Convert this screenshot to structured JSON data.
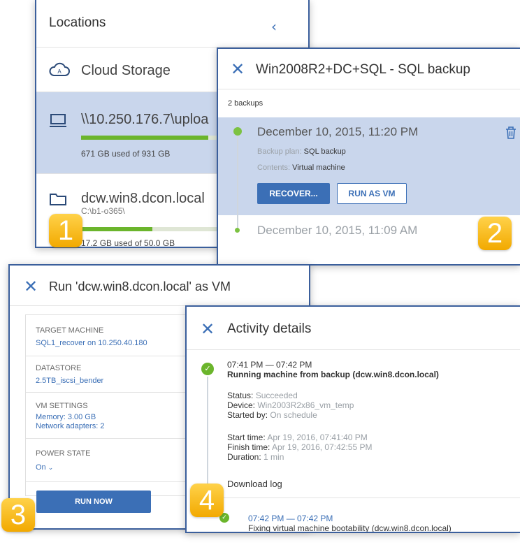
{
  "locations_panel": {
    "title": "Locations",
    "collapse_icon": "chevron-left-icon",
    "items": [
      {
        "icon": "cloud-icon",
        "name": "Cloud Storage"
      },
      {
        "icon": "computer-icon",
        "name": "\\\\10.250.176.7\\uploa",
        "usage": "671 GB used of 931 GB",
        "usage_fraction": 0.79,
        "selected": true
      },
      {
        "icon": "folder-icon",
        "name": "dcw.win8.dcon.local",
        "path": "C:\\b1-o365\\",
        "usage": "17.2 GB used of 50.0 GB",
        "usage_fraction": 0.34
      }
    ]
  },
  "backups_panel": {
    "title": "Win2008R2+DC+SQL - SQL backup",
    "count_label": "2 backups",
    "backups": [
      {
        "date": "December 10, 2015, 11:20 PM",
        "plan_label": "Backup plan:",
        "plan_value": "SQL backup",
        "contents_label": "Contents:",
        "contents_value": "Virtual machine",
        "recover_button": "RECOVER...",
        "run_vm_button": "RUN AS VM"
      },
      {
        "date": "December 10, 2015, 11:09 AM"
      }
    ]
  },
  "run_vm_panel": {
    "title": "Run 'dcw.win8.dcon.local' as VM",
    "target_label": "TARGET MACHINE",
    "target_value": "SQL1_recover on 10.250.40.180",
    "datastore_label": "DATASTORE",
    "datastore_value": "2.5TB_iscsi_bender",
    "settings_label": "VM SETTINGS",
    "memory": "Memory: 3.00 GB",
    "adapters": "Network adapters: 2",
    "power_label": "POWER STATE",
    "power_value": "On",
    "run_button": "RUN NOW"
  },
  "activity_panel": {
    "title": "Activity details",
    "activity1": {
      "time": "07:41 PM — 07:42 PM",
      "name": "Running machine from backup (dcw.win8.dcon.local)",
      "status_label": "Status:",
      "status_value": "Succeeded",
      "device_label": "Device:",
      "device_value": "Win2003R2x86_vm_temp",
      "started_label": "Started by:",
      "started_value": "On schedule",
      "start_label": "Start time:",
      "start_value": "Apr 19, 2016, 07:41:40 PM",
      "finish_label": "Finish time:",
      "finish_value": "Apr 19, 2016, 07:42:55 PM",
      "duration_label": "Duration:",
      "duration_value": "1 min",
      "download_link": "Download log"
    },
    "activity2": {
      "time": "07:42 PM — 07:42 PM",
      "name": "Fixing virtual machine bootability (dcw.win8.dcon.local)"
    }
  },
  "badges": [
    "1",
    "2",
    "3",
    "4"
  ],
  "colors": {
    "accent": "#3b6fb6",
    "success": "#6bb52c",
    "badge": "#f5b400",
    "selected_row": "#c9d6ec"
  }
}
